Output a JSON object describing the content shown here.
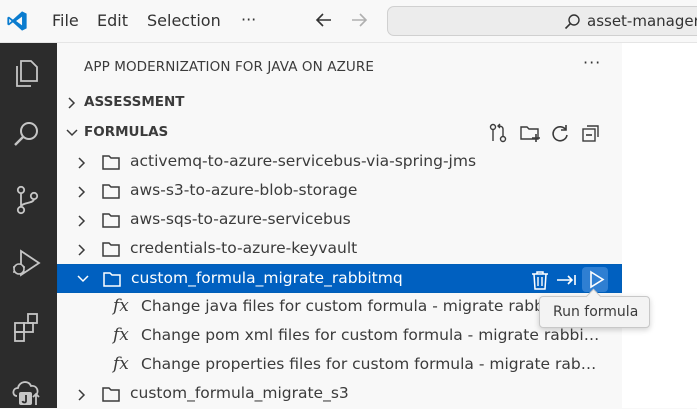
{
  "titlebar": {
    "menu": [
      "File",
      "Edit",
      "Selection",
      "···"
    ],
    "command_center_text": "asset-manager",
    "accent_color": "#007acc"
  },
  "activitybar": {
    "icons": [
      "explorer-icon",
      "search-icon",
      "source-control-icon",
      "run-debug-icon",
      "extensions-icon",
      "java-azure-icon"
    ]
  },
  "sidebar": {
    "title": "APP MODERNIZATION FOR JAVA ON AZURE",
    "more_label": "···",
    "sections": {
      "assessment": {
        "label": "ASSESSMENT",
        "expanded": false
      },
      "formulas": {
        "label": "FORMULAS",
        "expanded": true,
        "action_icons": [
          "connect-icon",
          "new-folder-icon",
          "refresh-icon",
          "collapse-all-icon"
        ]
      }
    },
    "items": [
      {
        "label": "activemq-to-azure-servicebus-via-spring-jms",
        "type": "folder",
        "expanded": false
      },
      {
        "label": "aws-s3-to-azure-blob-storage",
        "type": "folder",
        "expanded": false
      },
      {
        "label": "aws-sqs-to-azure-servicebus",
        "type": "folder",
        "expanded": false
      },
      {
        "label": "credentials-to-azure-keyvault",
        "type": "folder",
        "expanded": false
      },
      {
        "label": "custom_formula_migrate_rabbitmq",
        "type": "folder",
        "expanded": true,
        "selected": true
      },
      {
        "label": "Change java files for custom formula - migrate rabbitmq",
        "type": "formula-step"
      },
      {
        "label": "Change pom xml files for custom formula - migrate rabbitmq",
        "type": "formula-step"
      },
      {
        "label": "Change properties files for custom formula - migrate rabbitmq",
        "type": "formula-step"
      },
      {
        "label": "custom_formula_migrate_s3",
        "type": "folder",
        "expanded": false
      }
    ],
    "fx_glyph": "fx",
    "selected_color": "#0060c0"
  },
  "tooltip": {
    "text": "Run formula"
  }
}
